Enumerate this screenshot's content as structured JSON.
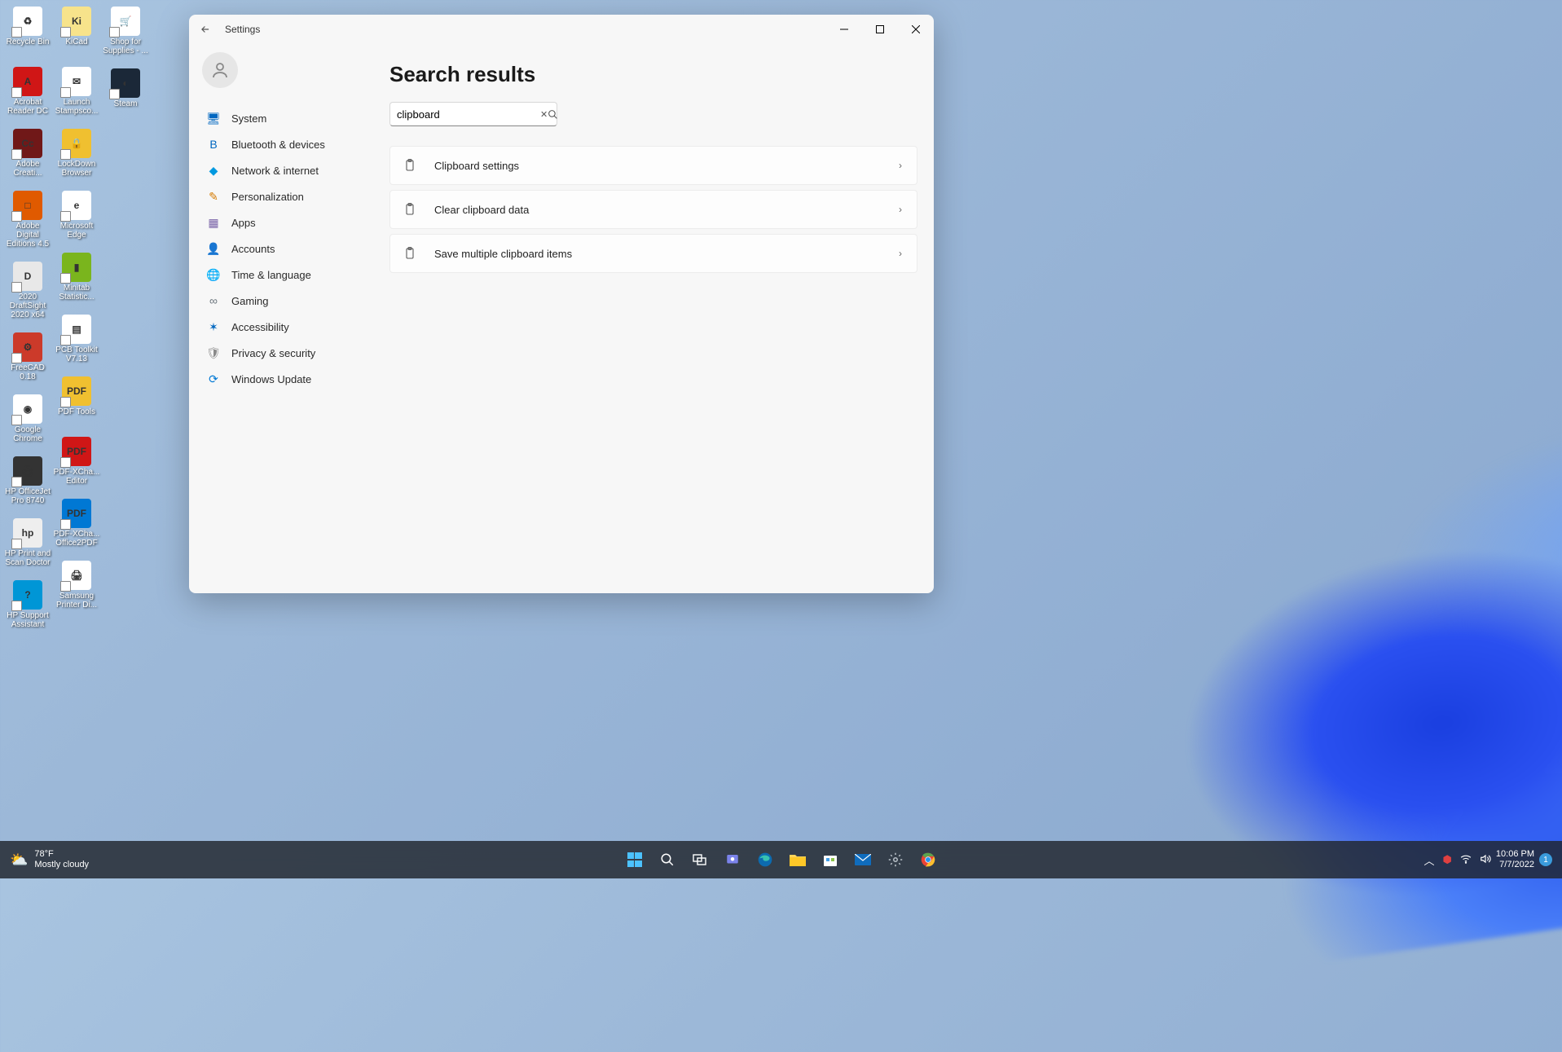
{
  "desktop": {
    "col1": [
      {
        "label": "Recycle Bin",
        "bg": "#fff",
        "glyph": "♻"
      },
      {
        "label": "Acrobat Reader DC",
        "bg": "#d01616",
        "glyph": "A"
      },
      {
        "label": "Adobe Creati...",
        "bg": "#701818",
        "glyph": "Cc"
      },
      {
        "label": "Adobe Digital Editions 4.5",
        "bg": "#e05a00",
        "glyph": "□"
      },
      {
        "label": "2020 DraftSight 2020 x64",
        "bg": "#e8e8e8",
        "glyph": "D"
      },
      {
        "label": "FreeCAD 0.18",
        "bg": "#cc3a2a",
        "glyph": "⚙"
      },
      {
        "label": "Google Chrome",
        "bg": "#fff",
        "glyph": "◉"
      },
      {
        "label": "HP OfficeJet Pro 8740",
        "bg": "#333",
        "glyph": "🖨"
      },
      {
        "label": "HP Print and Scan Doctor",
        "bg": "#eee",
        "glyph": "hp"
      },
      {
        "label": "HP Support Assistant",
        "bg": "#0096d6",
        "glyph": "?"
      }
    ],
    "col2": [
      {
        "label": "KiCad",
        "bg": "#f7e38b",
        "glyph": "Ki"
      },
      {
        "label": "Launch Stampsco...",
        "bg": "#fff",
        "glyph": "✉"
      },
      {
        "label": "LockDown Browser",
        "bg": "#f0c030",
        "glyph": "🔒"
      },
      {
        "label": "Microsoft Edge",
        "bg": "#fff",
        "glyph": "e"
      },
      {
        "label": "Minitab Statistic...",
        "bg": "#7ab51d",
        "glyph": "▮"
      },
      {
        "label": "PCB Toolkit V7.13",
        "bg": "#fff",
        "glyph": "▤"
      },
      {
        "label": "PDF Tools",
        "bg": "#f0c030",
        "glyph": "PDF"
      },
      {
        "label": "PDF-XCha... Editor",
        "bg": "#d01616",
        "glyph": "PDF"
      },
      {
        "label": "PDF-XCha... Office2PDF",
        "bg": "#0078d4",
        "glyph": "PDF"
      },
      {
        "label": "Samsung Printer Di...",
        "bg": "#fff",
        "glyph": "🖨"
      }
    ],
    "col3": [
      {
        "label": "Shop for Supplies - ...",
        "bg": "#fff",
        "glyph": "🛒"
      },
      {
        "label": "Steam",
        "bg": "#1b2838",
        "glyph": "◐"
      }
    ]
  },
  "settings": {
    "app_title": "Settings",
    "page_title": "Search results",
    "search_value": "clipboard",
    "nav": [
      {
        "label": "System",
        "icon": "🖥",
        "color": "#0067c0"
      },
      {
        "label": "Bluetooth & devices",
        "icon": "B",
        "color": "#0067c0"
      },
      {
        "label": "Network & internet",
        "icon": "◆",
        "color": "#0099e0"
      },
      {
        "label": "Personalization",
        "icon": "✎",
        "color": "#d47a00"
      },
      {
        "label": "Apps",
        "icon": "▦",
        "color": "#7a63a8"
      },
      {
        "label": "Accounts",
        "icon": "👤",
        "color": "#2aa8a8"
      },
      {
        "label": "Time & language",
        "icon": "🌐",
        "color": "#5ab0e0"
      },
      {
        "label": "Gaming",
        "icon": "∞",
        "color": "#6a747c"
      },
      {
        "label": "Accessibility",
        "icon": "✶",
        "color": "#0067c0"
      },
      {
        "label": "Privacy & security",
        "icon": "🛡",
        "color": "#8a8a8a"
      },
      {
        "label": "Windows Update",
        "icon": "⟳",
        "color": "#0078d4"
      }
    ],
    "results": [
      {
        "label": "Clipboard settings"
      },
      {
        "label": "Clear clipboard data"
      },
      {
        "label": "Save multiple clipboard items"
      }
    ]
  },
  "taskbar": {
    "weather_temp": "78°F",
    "weather_desc": "Mostly cloudy",
    "time": "10:06 PM",
    "date": "7/7/2022",
    "notif_count": "1"
  }
}
